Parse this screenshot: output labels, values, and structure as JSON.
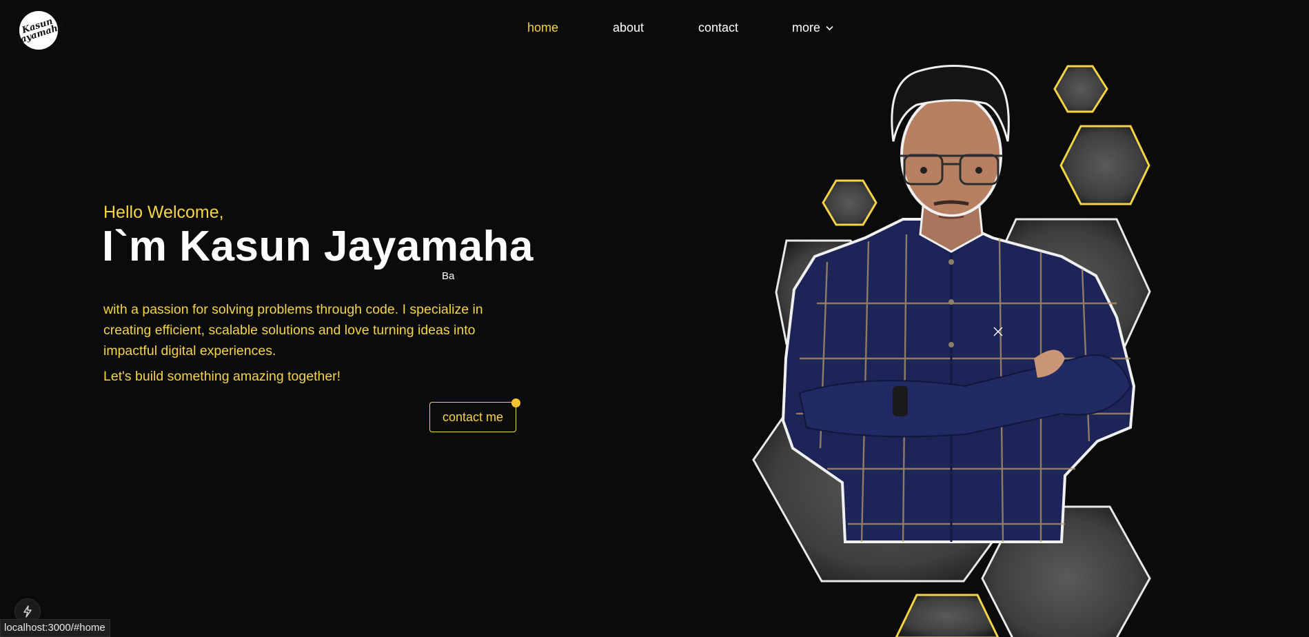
{
  "logo": {
    "text": "Kasun\nJayamaha"
  },
  "nav": {
    "items": [
      {
        "label": "home",
        "active": true
      },
      {
        "label": "about",
        "active": false
      },
      {
        "label": "contact",
        "active": false
      },
      {
        "label": "more",
        "active": false,
        "icon": "chevron-down-icon"
      }
    ]
  },
  "hero": {
    "greeting": "Hello Welcome,",
    "name": "I`m Kasun Jayamaha",
    "typed_text": "Ba",
    "bio": "with a passion for solving problems through code. I specialize in creating efficient, scalable solutions and love turning ideas into impactful digital experiences.",
    "cta_line": "Let's build something amazing together!",
    "contact_button": "contact me"
  },
  "status_bar": {
    "url": "localhost:3000/#home"
  },
  "colors": {
    "accent": "#f5d545",
    "background": "#0b0b0c",
    "text": "#ffffff",
    "hex_fill": "#4a4a4a",
    "shirt": "#1d2457"
  },
  "icons": {
    "dev_badge": "lightning-icon",
    "nav_more": "chevron-down-icon"
  }
}
